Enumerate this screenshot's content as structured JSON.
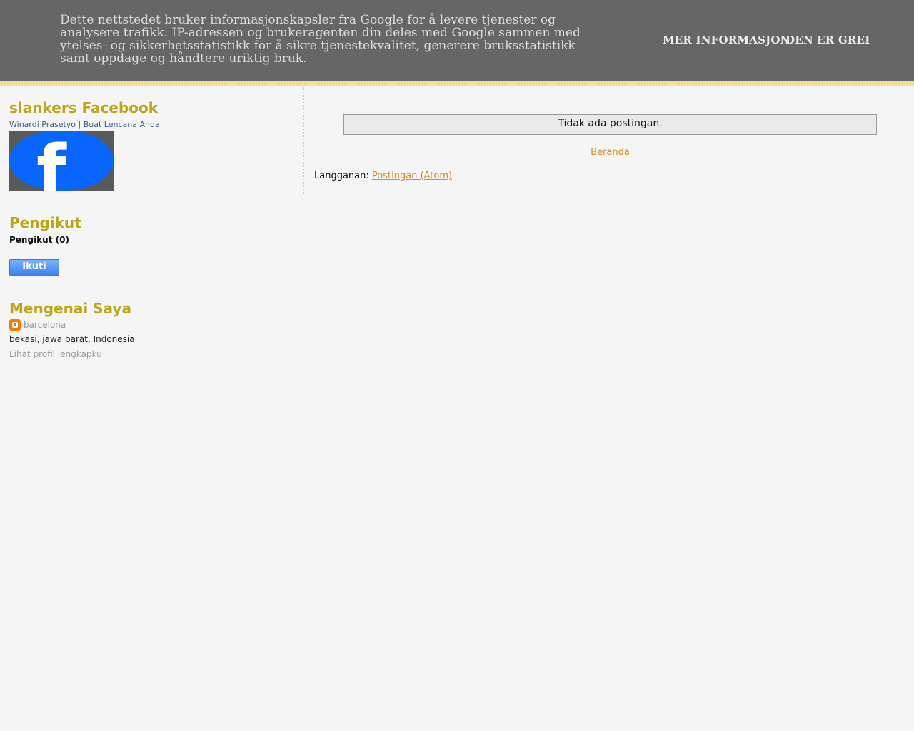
{
  "cookie_banner": {
    "text": "Dette nettstedet bruker informasjonskapsler fra Google for å levere tjenester og analysere trafikk. IP-adressen og brukeragenten din deles med Google sammen med ytelses- og sikkerhetsstatistikk for å sikre tjenestekvalitet, generere bruksstatistikk samt oppdage og håndtere uriktig bruk.",
    "more_info_label": "MER INFORMASJON",
    "ok_label": "DEN ER GREI"
  },
  "sidebar": {
    "facebook_widget": {
      "title": "slankers Facebook",
      "badge_link": "Winardi Prasetyo | Buat Lencana Anda",
      "badge_letter": "f"
    },
    "followers_widget": {
      "title": "Pengikut",
      "count_label": "Pengikut (0)",
      "follow_label": "Ikuti"
    },
    "about_widget": {
      "title": "Mengenai Saya",
      "name": "barcelona",
      "location": "bekasi, jawa barat, Indonesia",
      "profile_link": "Lihat profil lengkapku"
    }
  },
  "main": {
    "no_posts": "Tidak ada postingan.",
    "home_link": "Beranda",
    "subscribe_label": "Langganan: ",
    "subscribe_link": "Postingan (Atom)"
  },
  "colors": {
    "banner_bg": "#666666",
    "page_bg": "#f5f5f5",
    "widget_title": "#bba61a",
    "link_orange": "#d98a1a",
    "facebook_blue": "#0866ff"
  }
}
